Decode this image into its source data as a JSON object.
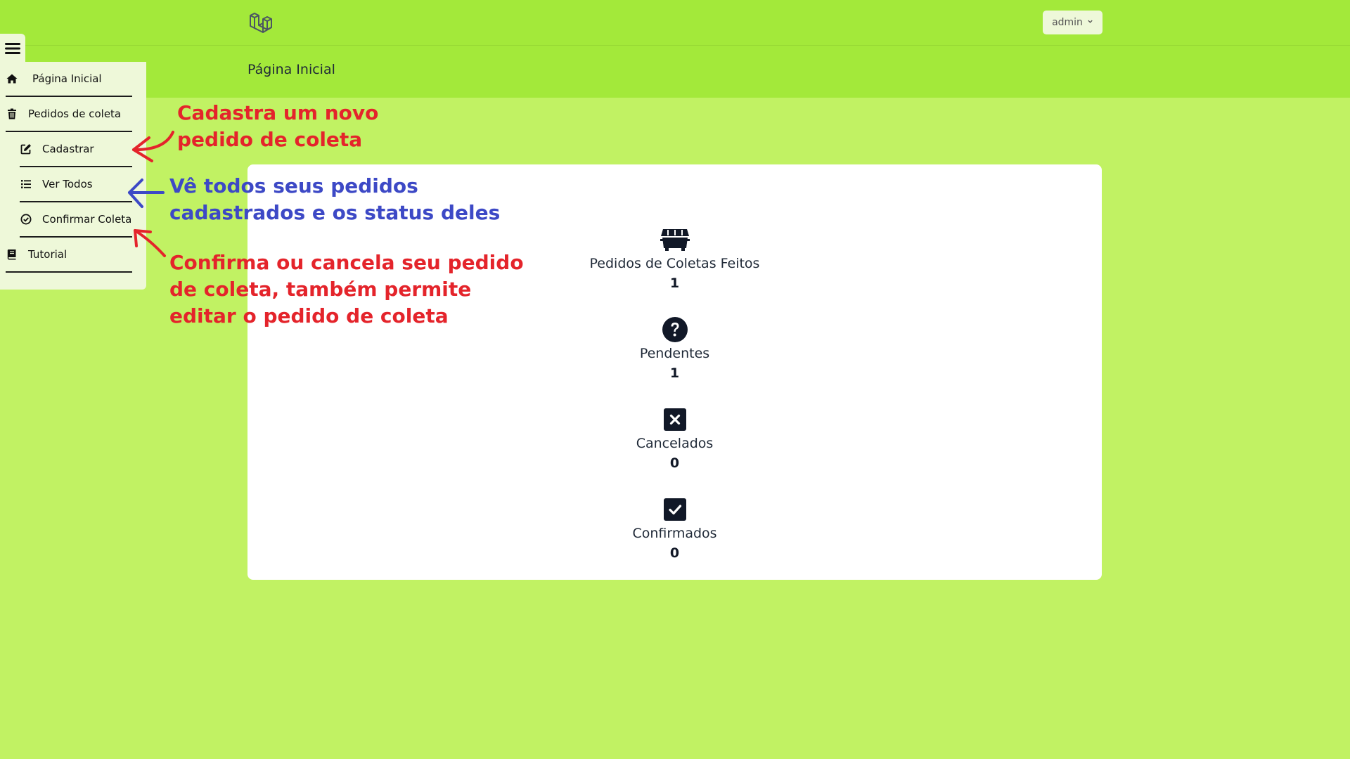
{
  "header": {
    "logo_icon": "laravel-logo-icon",
    "page_title": "Página Inicial",
    "user_menu_label": "admin"
  },
  "sidebar": {
    "toggle_icon": "hamburger-icon",
    "items": [
      {
        "label": "Página Inicial",
        "icon": "home-icon"
      },
      {
        "label": "Pedidos de coleta",
        "icon": "trash-icon"
      },
      {
        "label": "Cadastrar",
        "icon": "edit-icon"
      },
      {
        "label": "Ver Todos",
        "icon": "list-icon"
      },
      {
        "label": "Confirmar Coleta",
        "icon": "check-circle-icon"
      },
      {
        "label": "Tutorial",
        "icon": "book-icon"
      }
    ]
  },
  "stats": [
    {
      "label": "Pedidos de Coletas Feitos",
      "value": "1",
      "icon": "dumpster-icon"
    },
    {
      "label": "Pendentes",
      "value": "1",
      "icon": "question-circle-icon"
    },
    {
      "label": "Cancelados",
      "value": "0",
      "icon": "x-square-icon"
    },
    {
      "label": "Confirmados",
      "value": "0",
      "icon": "check-square-icon"
    }
  ],
  "annotations": {
    "cadastrar": [
      "Cadastra um novo",
      "pedido de coleta"
    ],
    "ver_todos": [
      "Vê todos seus pedidos",
      "cadastrados e os status deles"
    ],
    "confirmar": [
      "Confirma ou cancela seu pedido",
      "de coleta, também permite",
      "editar o pedido de coleta"
    ]
  },
  "colors": {
    "page_bg": "#c1f263",
    "header_bg": "#a3e93a",
    "sidebar_bg": "#eef8d9",
    "annotation_red": "#e4242b",
    "annotation_blue": "#3d49c6",
    "icon_dark": "#111827"
  }
}
